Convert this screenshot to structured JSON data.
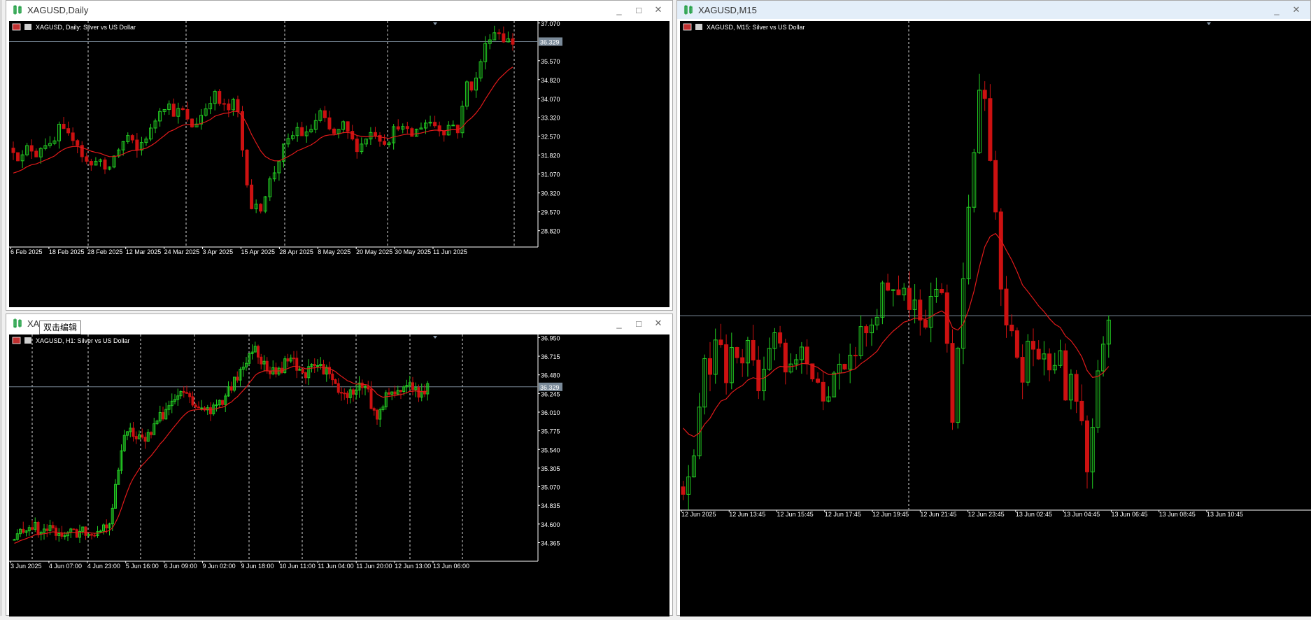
{
  "windows": [
    {
      "id": "daily",
      "title": "XAGUSD,Daily",
      "active": false,
      "buttons": [
        "_",
        "□",
        "✕"
      ]
    },
    {
      "id": "h1",
      "title": "XAGUSD,H1",
      "title_visible": "XAG",
      "active": false,
      "buttons": [
        "_",
        "□",
        "✕"
      ]
    },
    {
      "id": "m15",
      "title": "XAGUSD,M15",
      "active": true,
      "buttons": [
        "_",
        "✕"
      ]
    }
  ],
  "tooltip": "双击编辑",
  "colors": {
    "background": "#000000",
    "bull": "#22cc22",
    "bear": "#cc1111",
    "ma": "#e01a1a",
    "grid": "#ffffff",
    "axis_text": "#ffffff",
    "price_line": "#7a8a99",
    "price_tag_bg": "#7a8a99"
  },
  "chart_data": [
    {
      "type": "candlestick",
      "panel": "daily",
      "label": "XAGUSD, Daily:  Silver vs US Dollar",
      "ylim": [
        28.2,
        37.12
      ],
      "yticks": [
        "37.070",
        "36.329",
        "35.570",
        "34.820",
        "34.070",
        "33.320",
        "32.570",
        "31.820",
        "31.070",
        "30.320",
        "29.570",
        "28.820"
      ],
      "current_price": 36.329,
      "xtick_labels": [
        "6 Feb 2025",
        "18 Feb 2025",
        "28 Feb 2025",
        "12 Mar 2025",
        "24 Mar 2025",
        "3 Apr 2025",
        "15 Apr 2025",
        "28 Apr 2025",
        "8 May 2025",
        "20 May 2025",
        "30 May 2025",
        "11 Jun 2025"
      ],
      "path": [
        32.1,
        31.6,
        32.2,
        31.9,
        32.4,
        32.0,
        32.9,
        32.5,
        32.6,
        31.8,
        31.3,
        31.9,
        31.0,
        31.7,
        32.2,
        32.6,
        31.9,
        32.5,
        32.8,
        33.7,
        33.9,
        33.5,
        33.6,
        32.9,
        33.2,
        33.7,
        34.3,
        33.8,
        33.6,
        34.0,
        31.6,
        29.8,
        29.6,
        30.5,
        31.2,
        32.0,
        32.4,
        32.9,
        32.5,
        33.0,
        33.5,
        32.8,
        32.6,
        33.0,
        32.4,
        32.1,
        32.6,
        32.8,
        32.4,
        32.5,
        33.1,
        32.7,
        32.6,
        33.0,
        33.2,
        33.0,
        32.8,
        33.1,
        32.8,
        34.7,
        34.5,
        35.8,
        36.6,
        36.8,
        36.4,
        36.3
      ],
      "ma_start": 31.0
    },
    {
      "type": "candlestick",
      "panel": "h1",
      "label": "XAGUSD, H1:  Silver vs US Dollar",
      "ylim": [
        34.14,
        36.98
      ],
      "yticks": [
        "36.950",
        "36.715",
        "36.480",
        "36.329",
        "36.245",
        "36.010",
        "35.775",
        "35.540",
        "35.305",
        "35.070",
        "34.835",
        "34.600",
        "34.365"
      ],
      "current_price": 36.329,
      "xtick_labels": [
        "3 Jun 2025",
        "4 Jun 07:00",
        "4 Jun 23:00",
        "5 Jun 16:00",
        "6 Jun 09:00",
        "9 Jun 02:00",
        "9 Jun 18:00",
        "10 Jun 11:00",
        "11 Jun 04:00",
        "11 Jun 20:00",
        "12 Jun 13:00",
        "13 Jun 06:00"
      ],
      "path": [
        34.4,
        34.52,
        34.6,
        34.48,
        34.55,
        34.45,
        34.5,
        34.47,
        34.52,
        34.5,
        34.55,
        34.62,
        35.2,
        35.85,
        35.7,
        35.65,
        35.8,
        35.95,
        36.1,
        36.2,
        36.25,
        36.1,
        36.0,
        36.05,
        36.1,
        36.3,
        36.45,
        36.7,
        36.85,
        36.6,
        36.5,
        36.55,
        36.7,
        36.55,
        36.5,
        36.6,
        36.55,
        36.4,
        36.2,
        36.25,
        36.35,
        36.3,
        35.9,
        36.2,
        36.25,
        36.3,
        36.4,
        36.2,
        36.3
      ],
      "ma_start": 34.35
    },
    {
      "type": "candlestick",
      "panel": "m15",
      "label": "XAGUSD, M15:  Silver vs US Dollar",
      "ylim": [
        35.9,
        36.98
      ],
      "current_price": 36.329,
      "xtick_labels": [
        "12 Jun 2025",
        "12 Jun 13:45",
        "12 Jun 15:45",
        "12 Jun 17:45",
        "12 Jun 19:45",
        "12 Jun 21:45",
        "12 Jun 23:45",
        "13 Jun 02:45",
        "13 Jun 04:45",
        "13 Jun 06:45",
        "13 Jun 08:45",
        "13 Jun 10:45"
      ],
      "path": [
        35.95,
        35.98,
        36.1,
        36.25,
        36.22,
        36.3,
        36.18,
        36.26,
        36.2,
        36.28,
        36.22,
        36.15,
        36.25,
        36.3,
        36.24,
        36.2,
        36.22,
        36.28,
        36.2,
        36.18,
        36.15,
        36.2,
        36.24,
        36.22,
        36.25,
        36.28,
        36.3,
        36.32,
        36.38,
        36.4,
        36.36,
        36.38,
        36.35,
        36.34,
        36.32,
        36.36,
        36.4,
        36.3,
        36.1,
        36.35,
        36.5,
        36.7,
        36.88,
        36.7,
        36.55,
        36.35,
        36.3,
        36.25,
        36.2,
        36.3,
        36.22,
        36.25,
        36.2,
        36.28,
        36.15,
        36.2,
        36.1,
        36.0,
        36.15,
        36.25,
        36.3
      ],
      "ma_start": 36.1
    }
  ]
}
